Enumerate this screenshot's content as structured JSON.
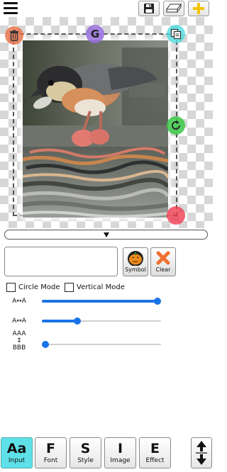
{
  "toolbar": {
    "menu_icon": "hamburger-icon",
    "save_icon": "floppy-disk-icon",
    "eraser_icon": "eraser-icon",
    "add_icon": "plus-icon",
    "add_color": "#f5c400"
  },
  "canvas": {
    "handles": {
      "top_left": "trash-icon",
      "top_center_label": "G",
      "top_right": "copy-icon",
      "right_middle": "rotate-icon",
      "bottom_right": "scale-icon"
    },
    "handle_colors": [
      "#e8764e",
      "#966edc",
      "#50dce1",
      "#3cc846",
      "#f03c50"
    ],
    "image": "photo of small bird with water reflection"
  },
  "collapse": {
    "icon": "triangle-down-icon"
  },
  "text_input": {
    "value": "",
    "placeholder": ""
  },
  "buttons": {
    "symbol_label": "Symbol",
    "symbol_icon": "pumpkin-icon",
    "clear_label": "Clear",
    "clear_icon": "close-x-icon",
    "clear_color": "#f07030"
  },
  "options": {
    "circle_mode": {
      "label": "Circle Mode",
      "checked": false
    },
    "vertical_mode": {
      "label": "Vertical Mode",
      "checked": false
    }
  },
  "sliders": [
    {
      "label": "A↔A",
      "value_fraction": 1.0
    },
    {
      "label": "A↔A",
      "value_fraction": 0.3
    },
    {
      "label_top": "AAA",
      "label_mid": "↕",
      "label_bottom": "BBB",
      "value_fraction": 0.0
    }
  ],
  "slider_color": "#1a73e8",
  "tabs": [
    {
      "icon": "Aa",
      "label": "Input",
      "active": true
    },
    {
      "icon": "F",
      "label": "Font",
      "active": false
    },
    {
      "icon": "S",
      "label": "Style",
      "active": false
    },
    {
      "icon": "I",
      "label": "Image",
      "active": false
    },
    {
      "icon": "E",
      "label": "Effect",
      "active": false
    }
  ],
  "active_tab_color": "#5ee0e8",
  "swap": {
    "icon": "up-down-arrows-icon"
  }
}
